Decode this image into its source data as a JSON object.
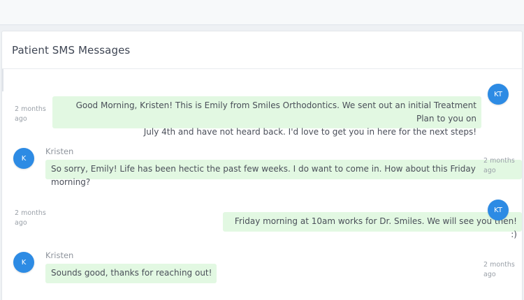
{
  "panel": {
    "title": "Patient SMS Messages"
  },
  "theme": {
    "avatar_color": "#2d8be4",
    "bubble_color": "#e2f8e2"
  },
  "messages": [
    {
      "direction": "outgoing",
      "avatar": "KT",
      "time_line1": "2 months",
      "time_line2": "ago",
      "text_line1": "Good Morning, Kristen! This is Emily from Smiles Orthodontics. We sent out an initial Treatment Plan to you on",
      "text_line2": "July 4th and have not heard back. I'd love to get you in here for the next steps!"
    },
    {
      "direction": "incoming",
      "avatar": "K",
      "sender": "Kristen",
      "time_line1": "2 months",
      "time_line2": "ago",
      "text": "So sorry, Emily! Life has been hectic the past few weeks. I do want to come in. How about this Friday morning?"
    },
    {
      "direction": "outgoing",
      "avatar": "KT",
      "time_line1": "2 months",
      "time_line2": "ago",
      "text": "Friday morning at 10am works for Dr. Smiles. We will see you then! :)"
    },
    {
      "direction": "incoming",
      "avatar": "K",
      "sender": "Kristen",
      "time_line1": "2 months",
      "time_line2": "ago",
      "text": "Sounds good, thanks for reaching out!"
    }
  ]
}
